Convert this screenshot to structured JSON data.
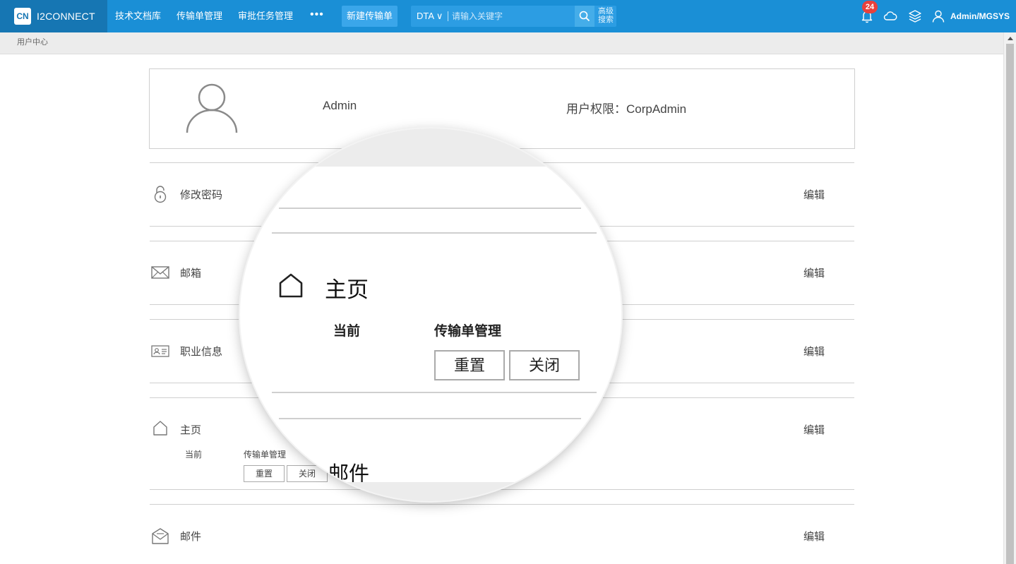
{
  "app": {
    "brand_logo_text": "CN",
    "brand_name": "I2CONNECT"
  },
  "nav": {
    "items": [
      "技术文档库",
      "传输单管理",
      "审批任务管理"
    ],
    "more": "•••",
    "new_button": "新建传输单"
  },
  "search": {
    "scope": "DTA ∨",
    "placeholder": "请输入关键字",
    "advanced_line1": "高级",
    "advanced_line2": "搜索"
  },
  "toolbar": {
    "notification_count": "24",
    "user": "Admin/MGSYS"
  },
  "breadcrumb": "用户中心",
  "profile": {
    "name": "Admin",
    "role": "用户权限：CorpAdmin"
  },
  "sections": {
    "password": {
      "title": "修改密码",
      "edit": "编辑"
    },
    "email": {
      "title": "邮箱",
      "edit": "编辑"
    },
    "job": {
      "title": "职业信息",
      "edit": "编辑"
    },
    "home": {
      "title": "主页",
      "edit": "编辑",
      "current_label": "当前",
      "current_value": "传输单管理",
      "reset_button": "重置",
      "close_button": "关闭"
    },
    "mail": {
      "title": "邮件",
      "edit": "编辑"
    }
  },
  "magnifier": {
    "title": "主页",
    "current_label": "当前",
    "current_value": "传输单管理",
    "reset_button": "重置",
    "close_button": "关闭",
    "partial_text": "邮件"
  },
  "colors": {
    "topbar": "#1a8fd6",
    "brand_bg": "#1676b3",
    "badge": "#e8413c"
  }
}
